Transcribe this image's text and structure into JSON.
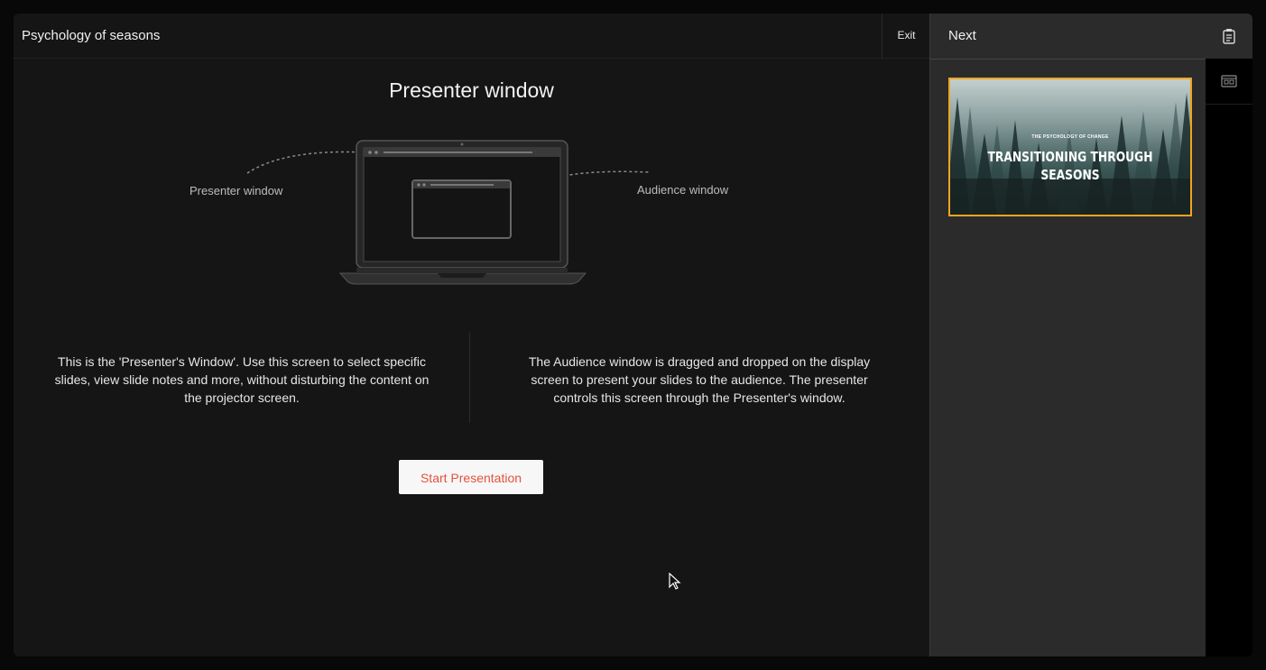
{
  "header": {
    "doc_title": "Psychology of seasons",
    "exit_label": "Exit"
  },
  "main": {
    "title": "Presenter window",
    "illustration": {
      "presenter_label": "Presenter window",
      "audience_label": "Audience window"
    },
    "presenter_desc": "This is the 'Presenter's Window'. Use this screen to select specific slides, view slide notes and more, without disturbing the content on the projector screen.",
    "audience_desc": "The Audience window is dragged and dropped on the display screen to present your slides to the audience. The presenter controls this screen through the Presenter's window.",
    "start_label": "Start Presentation"
  },
  "side": {
    "title": "Next",
    "next_slide": {
      "kicker": "THE PSYCHOLOGY OF CHANGE",
      "title_line1": "TRANSITIONING THROUGH",
      "title_line2": "SEASONS"
    }
  },
  "rail": {
    "icons": [
      "notes-icon",
      "slides-icon"
    ]
  },
  "colors": {
    "accent": "#e2533d",
    "selection": "#f0a422",
    "panel": "#2b2b2b",
    "background": "#151515"
  }
}
